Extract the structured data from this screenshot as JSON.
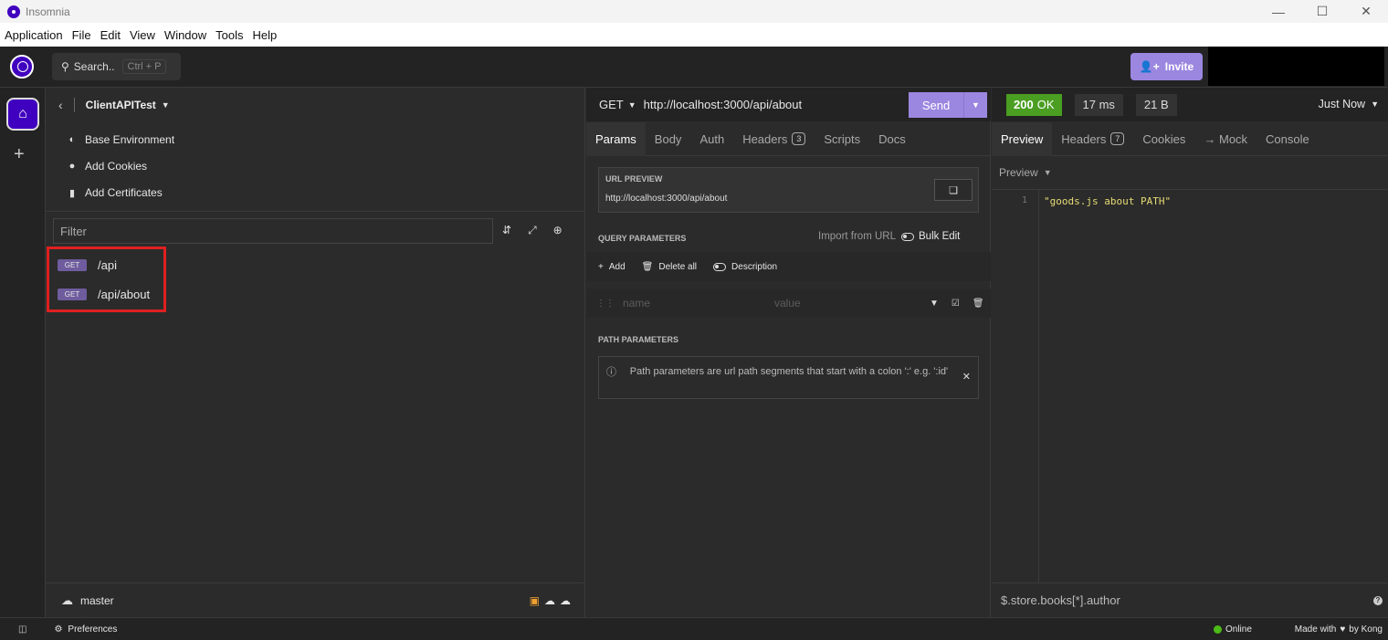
{
  "window": {
    "title": "Insomnia",
    "minimize": "—",
    "maximize": "☐",
    "close": "✕"
  },
  "menu": [
    "Application",
    "File",
    "Edit",
    "View",
    "Window",
    "Tools",
    "Help"
  ],
  "header": {
    "search_label": "Search..",
    "search_shortcut": "Ctrl + P",
    "invite_label": "Invite"
  },
  "sidebar": {
    "project_name": "ClientAPITest",
    "env_items": [
      {
        "label": "Base Environment",
        "icon": "globe-icon"
      },
      {
        "label": "Add Cookies",
        "icon": "cookie-icon"
      },
      {
        "label": "Add Certificates",
        "icon": "certificate-icon"
      }
    ],
    "filter_placeholder": "Filter",
    "requests": [
      {
        "method": "GET",
        "path": "/api"
      },
      {
        "method": "GET",
        "path": "/api/about"
      }
    ],
    "branch": "master"
  },
  "request": {
    "method": "GET",
    "url": "http://localhost:3000/api/about",
    "send_label": "Send",
    "tabs": [
      {
        "label": "Params",
        "active": true
      },
      {
        "label": "Body"
      },
      {
        "label": "Auth"
      },
      {
        "label": "Headers",
        "count": "3"
      },
      {
        "label": "Scripts"
      },
      {
        "label": "Docs"
      }
    ],
    "url_preview_caption": "URL PREVIEW",
    "url_preview_value": "http://localhost:3000/api/about",
    "query_params_title": "QUERY PARAMETERS",
    "import_from_url": "Import from URL",
    "bulk_edit": "Bulk Edit",
    "add_label": "Add",
    "delete_all_label": "Delete all",
    "description_label": "Description",
    "name_placeholder": "name",
    "value_placeholder": "value",
    "path_params_title": "PATH PARAMETERS",
    "path_params_note": "Path parameters are url path segments that start with a colon ':' e.g. ':id'"
  },
  "response": {
    "status_code": "200",
    "status_text": "OK",
    "time": "17 ms",
    "size": "21 B",
    "when": "Just Now",
    "tabs": [
      {
        "label": "Preview",
        "active": true
      },
      {
        "label": "Headers",
        "count": "7"
      },
      {
        "label": "Cookies"
      },
      {
        "label": "→ Mock"
      },
      {
        "label": "Console"
      }
    ],
    "preview_mode": "Preview",
    "line_number": "1",
    "body": "\"goods.js about PATH\"",
    "jsonpath_placeholder": "$.store.books[*].author"
  },
  "statusbar": {
    "preferences": "Preferences",
    "online": "Online",
    "made_with": "Made with",
    "by": "by Kong"
  },
  "colors": {
    "accent": "#9b87e0",
    "brand": "#4000bf",
    "status_ok": "#4a9e22",
    "highlight_box": "#e02020"
  }
}
